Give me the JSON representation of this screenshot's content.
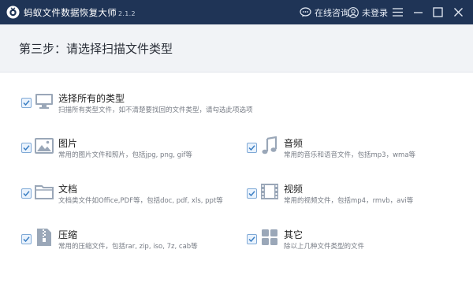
{
  "titlebar": {
    "app_name": "蚂蚁文件数据恢复大师",
    "version": "2.1.2",
    "consult_label": "在线咨询",
    "login_label": "未登录"
  },
  "header": {
    "step_title": "第三步：请选择扫描文件类型"
  },
  "file_types": {
    "all": {
      "label": "选择所有的类型",
      "desc": "扫描所有类型文件，如不清楚要找回的文件类型，请勾选此项选项",
      "checked": true,
      "icon": "monitor-icon"
    },
    "images": {
      "label": "图片",
      "desc": "常用的图片文件和照片，包括jpg, png, gif等",
      "checked": true,
      "icon": "image-icon"
    },
    "audio": {
      "label": "音频",
      "desc": "常用的音乐和语音文件，包括mp3，wma等",
      "checked": true,
      "icon": "music-icon"
    },
    "documents": {
      "label": "文档",
      "desc": "文档类文件如Office,PDF等，包括doc, pdf, xls, ppt等",
      "checked": true,
      "icon": "folder-icon"
    },
    "video": {
      "label": "视频",
      "desc": "常用的视频文件，包括mp4，rmvb，avi等",
      "checked": true,
      "icon": "film-icon"
    },
    "archives": {
      "label": "压缩",
      "desc": "常用的压缩文件，包括rar, zip, iso, 7z, cab等",
      "checked": true,
      "icon": "zip-icon"
    },
    "other": {
      "label": "其它",
      "desc": "除以上几种文件类型的文件",
      "checked": true,
      "icon": "grid-icon"
    }
  },
  "colors": {
    "titlebar_bg": "#1f3456",
    "header_bg": "#f1f3f6",
    "icon_color": "#9aa7b8",
    "check_color": "#3b7fc4"
  }
}
